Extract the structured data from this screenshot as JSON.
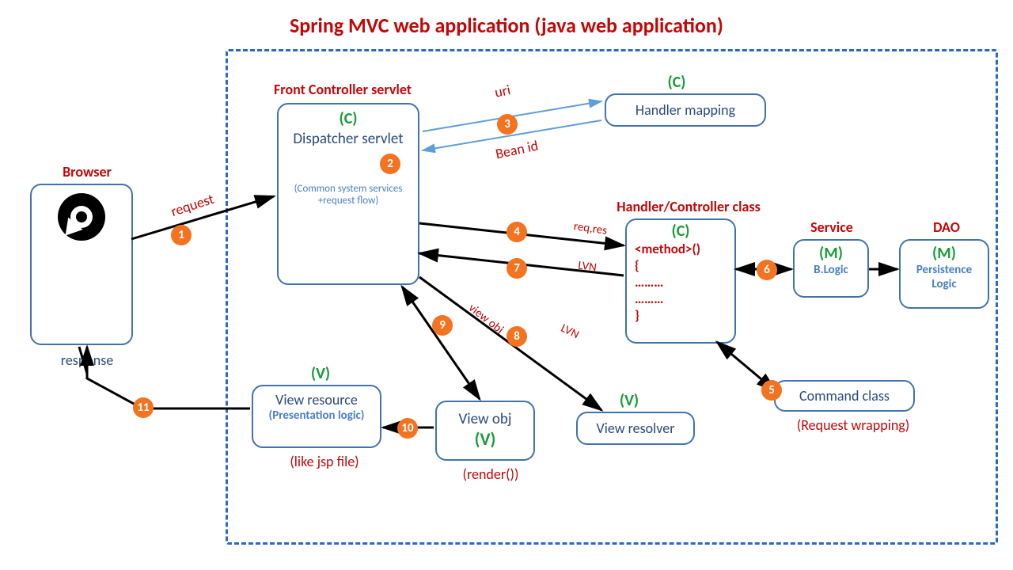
{
  "title": "Spring MVC web application (java web application)",
  "browser": {
    "label": "Browser",
    "response": "response"
  },
  "frontController": {
    "label": "Front Controller servlet",
    "mvc": "(C)",
    "name": "Dispatcher servlet",
    "sub": "(Common system services +request flow)"
  },
  "handlerMapping": {
    "mvc": "(C)",
    "name": "Handler mapping"
  },
  "handlerController": {
    "label": "Handler/Controller class",
    "mvc": "(C)",
    "code1": "<method>()",
    "code2": "{",
    "code3": "………",
    "code4": "………",
    "code5": "}"
  },
  "service": {
    "label": "Service",
    "mvc": "(M)",
    "sub": "B.Logic"
  },
  "dao": {
    "label": "DAO",
    "mvc": "(M)",
    "sub": "Persistence Logic"
  },
  "commandClass": {
    "name": "Command class",
    "sub": "(Request wrapping)"
  },
  "viewResolver": {
    "mvc": "(V)",
    "name": "View resolver"
  },
  "viewObj": {
    "name": "View obj",
    "mvc": "(V)",
    "sub": "(render())"
  },
  "viewResource": {
    "mvc": "(V)",
    "name": "View resource",
    "sub": "(Presentation logic)",
    "note": "(like jsp file)"
  },
  "arrows": {
    "request": "request",
    "uri": "uri",
    "beanId": "Bean id",
    "reqRes": "req,res",
    "lvn1": "LVN",
    "lvn2": "LVN",
    "viewObj": "view obj"
  },
  "steps": [
    "1",
    "2",
    "3",
    "4",
    "5",
    "6",
    "7",
    "8",
    "9",
    "10",
    "11"
  ]
}
